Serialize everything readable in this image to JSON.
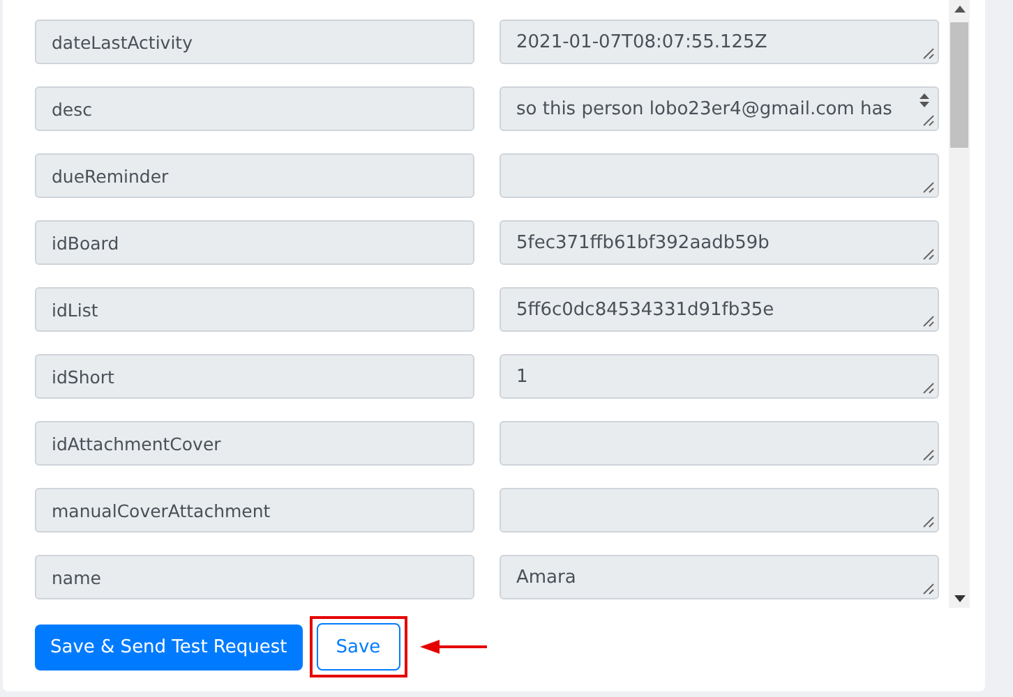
{
  "fields": [
    {
      "key": "dateLastActivity",
      "value": "2021-01-07T08:07:55.125Z",
      "scrollable": false
    },
    {
      "key": "desc",
      "value": "so this person lobo23er4@gmail.com has",
      "scrollable": true
    },
    {
      "key": "dueReminder",
      "scrollable": false
    },
    {
      "key": "idBoard",
      "value": "5fec371ffb61bf392aadb59b",
      "scrollable": false
    },
    {
      "key": "idList",
      "value": "5ff6c0dc84534331d91fb35e",
      "scrollable": false
    },
    {
      "key": "idShort",
      "value": "1",
      "scrollable": false
    },
    {
      "key": "idAttachmentCover",
      "scrollable": false
    },
    {
      "key": "manualCoverAttachment",
      "scrollable": false
    },
    {
      "key": "name",
      "value": "Amara",
      "scrollable": false
    }
  ],
  "buttons": {
    "primary": "Save & Send Test Request",
    "secondary": "Save"
  }
}
